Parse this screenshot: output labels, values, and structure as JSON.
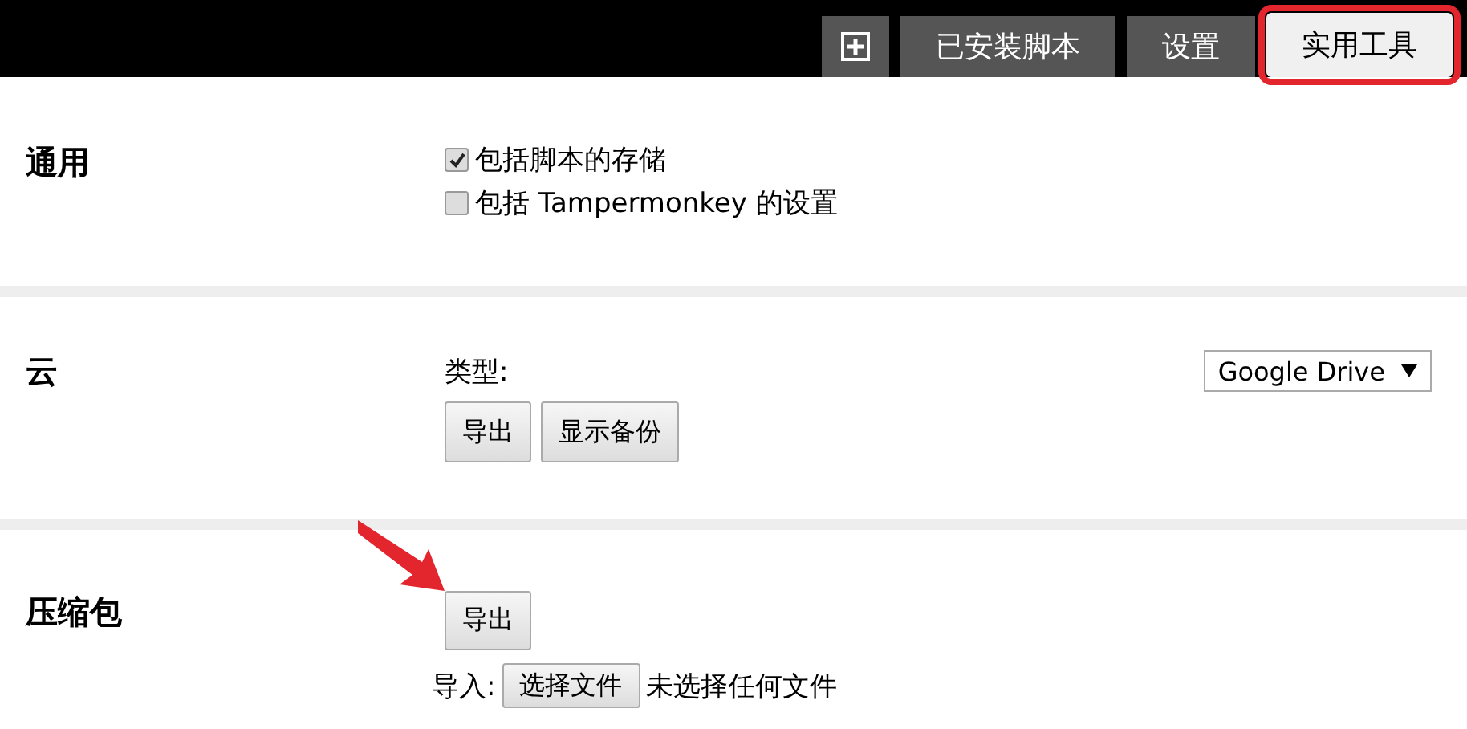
{
  "tabs": [
    {
      "kind": "add",
      "selected": false,
      "highlighted": false
    },
    {
      "kind": "text",
      "label": "已安装脚本",
      "selected": false,
      "highlighted": false
    },
    {
      "kind": "text",
      "label": "设置",
      "selected": false,
      "highlighted": false
    },
    {
      "kind": "text",
      "label": "实用工具",
      "selected": true,
      "highlighted": true
    }
  ],
  "sections": [
    {
      "kind": "options",
      "title": "通用",
      "options": [
        {
          "label": "包括脚本的存储",
          "checked": true
        },
        {
          "label": "包括 Tampermonkey 的设置",
          "checked": false
        }
      ]
    },
    {
      "kind": "cloud",
      "title": "云",
      "type_label": "类型:",
      "select": {
        "value": "Google Drive"
      },
      "buttons": [
        "导出",
        "显示备份"
      ]
    },
    {
      "kind": "zip",
      "title": "压缩包",
      "buttons": [
        "导出"
      ],
      "arrow": true,
      "import_label": "导入:",
      "file_button": "选择文件",
      "file_status": "未选择任何文件"
    }
  ]
}
